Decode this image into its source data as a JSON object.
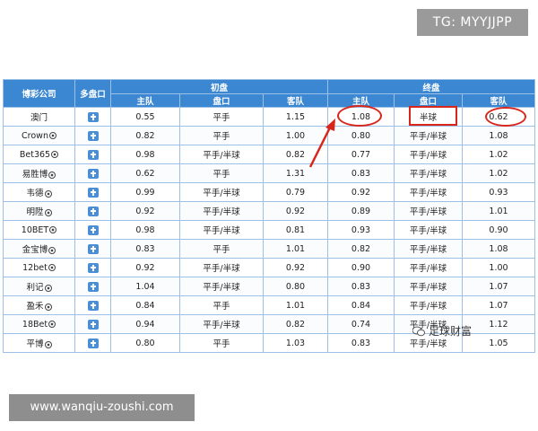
{
  "watermarks": {
    "telegram": "TG: MYYJJPP",
    "url": "www.wanqiu-zoushi.com",
    "wechat": "足球财富"
  },
  "table": {
    "headers": {
      "company": "博彩公司",
      "multi": "多盘口",
      "initial": "初盘",
      "final": "终盘",
      "home": "主队",
      "handicap": "盘口",
      "away": "客队"
    },
    "rows": [
      {
        "company": "澳门",
        "ball": false,
        "init_home": "0.55",
        "init_hcp": "平手",
        "init_away": "1.15",
        "fin_home": "1.08",
        "fin_hcp": "半球",
        "fin_away": "0.62"
      },
      {
        "company": "Crown",
        "ball": true,
        "init_home": "0.82",
        "init_hcp": "平手",
        "init_away": "1.00",
        "fin_home": "0.80",
        "fin_hcp": "平手/半球",
        "fin_away": "1.08"
      },
      {
        "company": "Bet365",
        "ball": true,
        "init_home": "0.98",
        "init_hcp": "平手/半球",
        "init_away": "0.82",
        "fin_home": "0.77",
        "fin_hcp": "平手/半球",
        "fin_away": "1.02"
      },
      {
        "company": "易胜博",
        "ball": true,
        "init_home": "0.62",
        "init_hcp": "平手",
        "init_away": "1.31",
        "fin_home": "0.83",
        "fin_hcp": "平手/半球",
        "fin_away": "1.02"
      },
      {
        "company": "韦德",
        "ball": true,
        "init_home": "0.99",
        "init_hcp": "平手/半球",
        "init_away": "0.79",
        "fin_home": "0.92",
        "fin_hcp": "平手/半球",
        "fin_away": "0.93"
      },
      {
        "company": "明陞",
        "ball": true,
        "init_home": "0.92",
        "init_hcp": "平手/半球",
        "init_away": "0.92",
        "fin_home": "0.89",
        "fin_hcp": "平手/半球",
        "fin_away": "1.01"
      },
      {
        "company": "10BET",
        "ball": true,
        "init_home": "0.98",
        "init_hcp": "平手/半球",
        "init_away": "0.81",
        "fin_home": "0.93",
        "fin_hcp": "平手/半球",
        "fin_away": "0.90"
      },
      {
        "company": "金宝博",
        "ball": true,
        "init_home": "0.83",
        "init_hcp": "平手",
        "init_away": "1.01",
        "fin_home": "0.82",
        "fin_hcp": "平手/半球",
        "fin_away": "1.08"
      },
      {
        "company": "12bet",
        "ball": true,
        "init_home": "0.92",
        "init_hcp": "平手/半球",
        "init_away": "0.92",
        "fin_home": "0.90",
        "fin_hcp": "平手/半球",
        "fin_away": "1.00"
      },
      {
        "company": "利记",
        "ball": true,
        "init_home": "1.04",
        "init_hcp": "平手/半球",
        "init_away": "0.80",
        "fin_home": "0.83",
        "fin_hcp": "平手/半球",
        "fin_away": "1.07"
      },
      {
        "company": "盈禾",
        "ball": true,
        "init_home": "0.84",
        "init_hcp": "平手",
        "init_away": "1.01",
        "fin_home": "0.84",
        "fin_hcp": "平手/半球",
        "fin_away": "1.07"
      },
      {
        "company": "18Bet",
        "ball": true,
        "init_home": "0.94",
        "init_hcp": "平手/半球",
        "init_away": "0.82",
        "fin_home": "0.74",
        "fin_hcp": "平手/半球",
        "fin_away": "1.12"
      },
      {
        "company": "平博",
        "ball": true,
        "init_home": "0.80",
        "init_hcp": "平手",
        "init_away": "1.03",
        "fin_home": "0.83",
        "fin_hcp": "平手/半球",
        "fin_away": "1.05"
      }
    ]
  },
  "colors": {
    "header_bg": "#3b87d1",
    "border": "#9cc0e6",
    "highlight": "#d9261c"
  }
}
